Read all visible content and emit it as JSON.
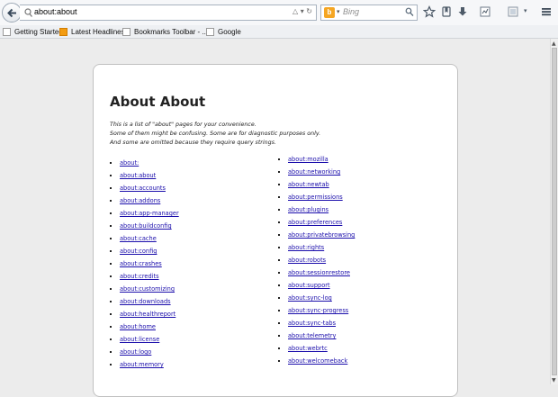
{
  "toolbar": {
    "url": "about:about",
    "search_placeholder": "Bing",
    "search_engine_letter": "b"
  },
  "bookmarks": [
    "Getting Started",
    "Latest Headlines",
    "Bookmarks Toolbar - ...",
    "Google"
  ],
  "page": {
    "title": "About About",
    "intro": [
      "This is a list of \"about\" pages for your convenience.",
      "Some of them might be confusing. Some are for diagnostic purposes only.",
      "And some are omitted because they require query strings."
    ],
    "left_links": [
      "about:",
      "about:about",
      "about:accounts",
      "about:addons",
      "about:app-manager",
      "about:buildconfig",
      "about:cache",
      "about:config",
      "about:crashes",
      "about:credits",
      "about:customizing",
      "about:downloads",
      "about:healthreport",
      "about:home",
      "about:license",
      "about:logo",
      "about:memory"
    ],
    "right_links": [
      "about:mozilla",
      "about:networking",
      "about:newtab",
      "about:permissions",
      "about:plugins",
      "about:preferences",
      "about:privatebrowsing",
      "about:rights",
      "about:robots",
      "about:sessionrestore",
      "about:support",
      "about:sync-log",
      "about:sync-progress",
      "about:sync-tabs",
      "about:telemetry",
      "about:webrtc",
      "about:welcomeback"
    ]
  }
}
